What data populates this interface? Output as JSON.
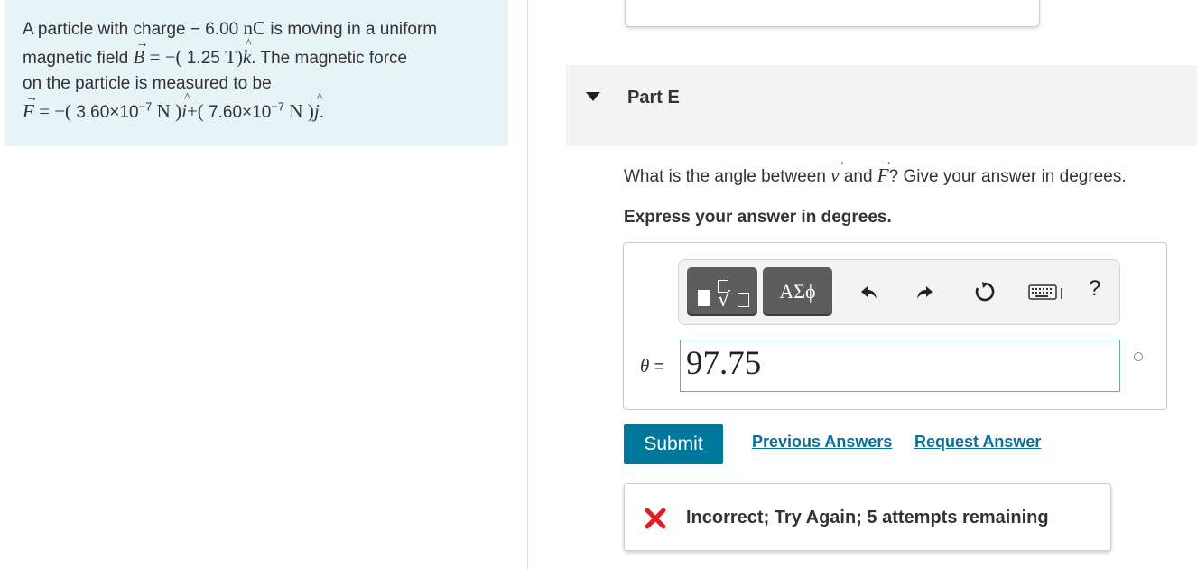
{
  "problem": {
    "line1_pre": "A particle with charge",
    "line1_minus": "−",
    "line1_value": "6.00",
    "line1_unit": "nC",
    "line1_post": "is moving in a uniform",
    "line2_pre": "magnetic field",
    "line2_var": "B",
    "line2_eq": "= −(",
    "line2_value": "1.25",
    "line2_unit": "T",
    "line2_close": ")",
    "line2_hat": "k",
    "line2_post": ". The magnetic force",
    "line3": "on the particle is measured to be",
    "line4_var": "F",
    "line4_eq": "= −(",
    "line4_v1": "3.60×10",
    "line4_e1": "−7",
    "line4_u1": "N",
    "line4_mid": ")",
    "line4_i": "i",
    "line4_plus": "+(",
    "line4_v2": "7.60×10",
    "line4_e2": "−7",
    "line4_u2": "N",
    "line4_close": ")",
    "line4_j": "j",
    "line4_end": "."
  },
  "part": {
    "title": "Part E",
    "question_pre": "What is the angle between",
    "question_v": "v",
    "question_and": "and",
    "question_F": "F",
    "question_post": "? Give your answer in degrees.",
    "express": "Express your answer in degrees."
  },
  "toolbar": {
    "greek_label": "ΑΣϕ",
    "help_label": "?",
    "icons": [
      "templates-icon",
      "greek-symbols-icon",
      "undo-icon",
      "redo-icon",
      "reset-icon",
      "keyboard-icon",
      "help-icon"
    ]
  },
  "answer": {
    "variable": "θ",
    "equals": "=",
    "value": "97.75"
  },
  "actions": {
    "submit_label": "Submit",
    "previous_label": "Previous Answers",
    "request_label": "Request Answer"
  },
  "feedback": {
    "text": "Incorrect; Try Again; 5 attempts remaining"
  },
  "colors": {
    "problem_bg": "#e7f4f6",
    "submit_bg": "#00789c",
    "link": "#0a6f9a",
    "error": "#e31b23"
  }
}
